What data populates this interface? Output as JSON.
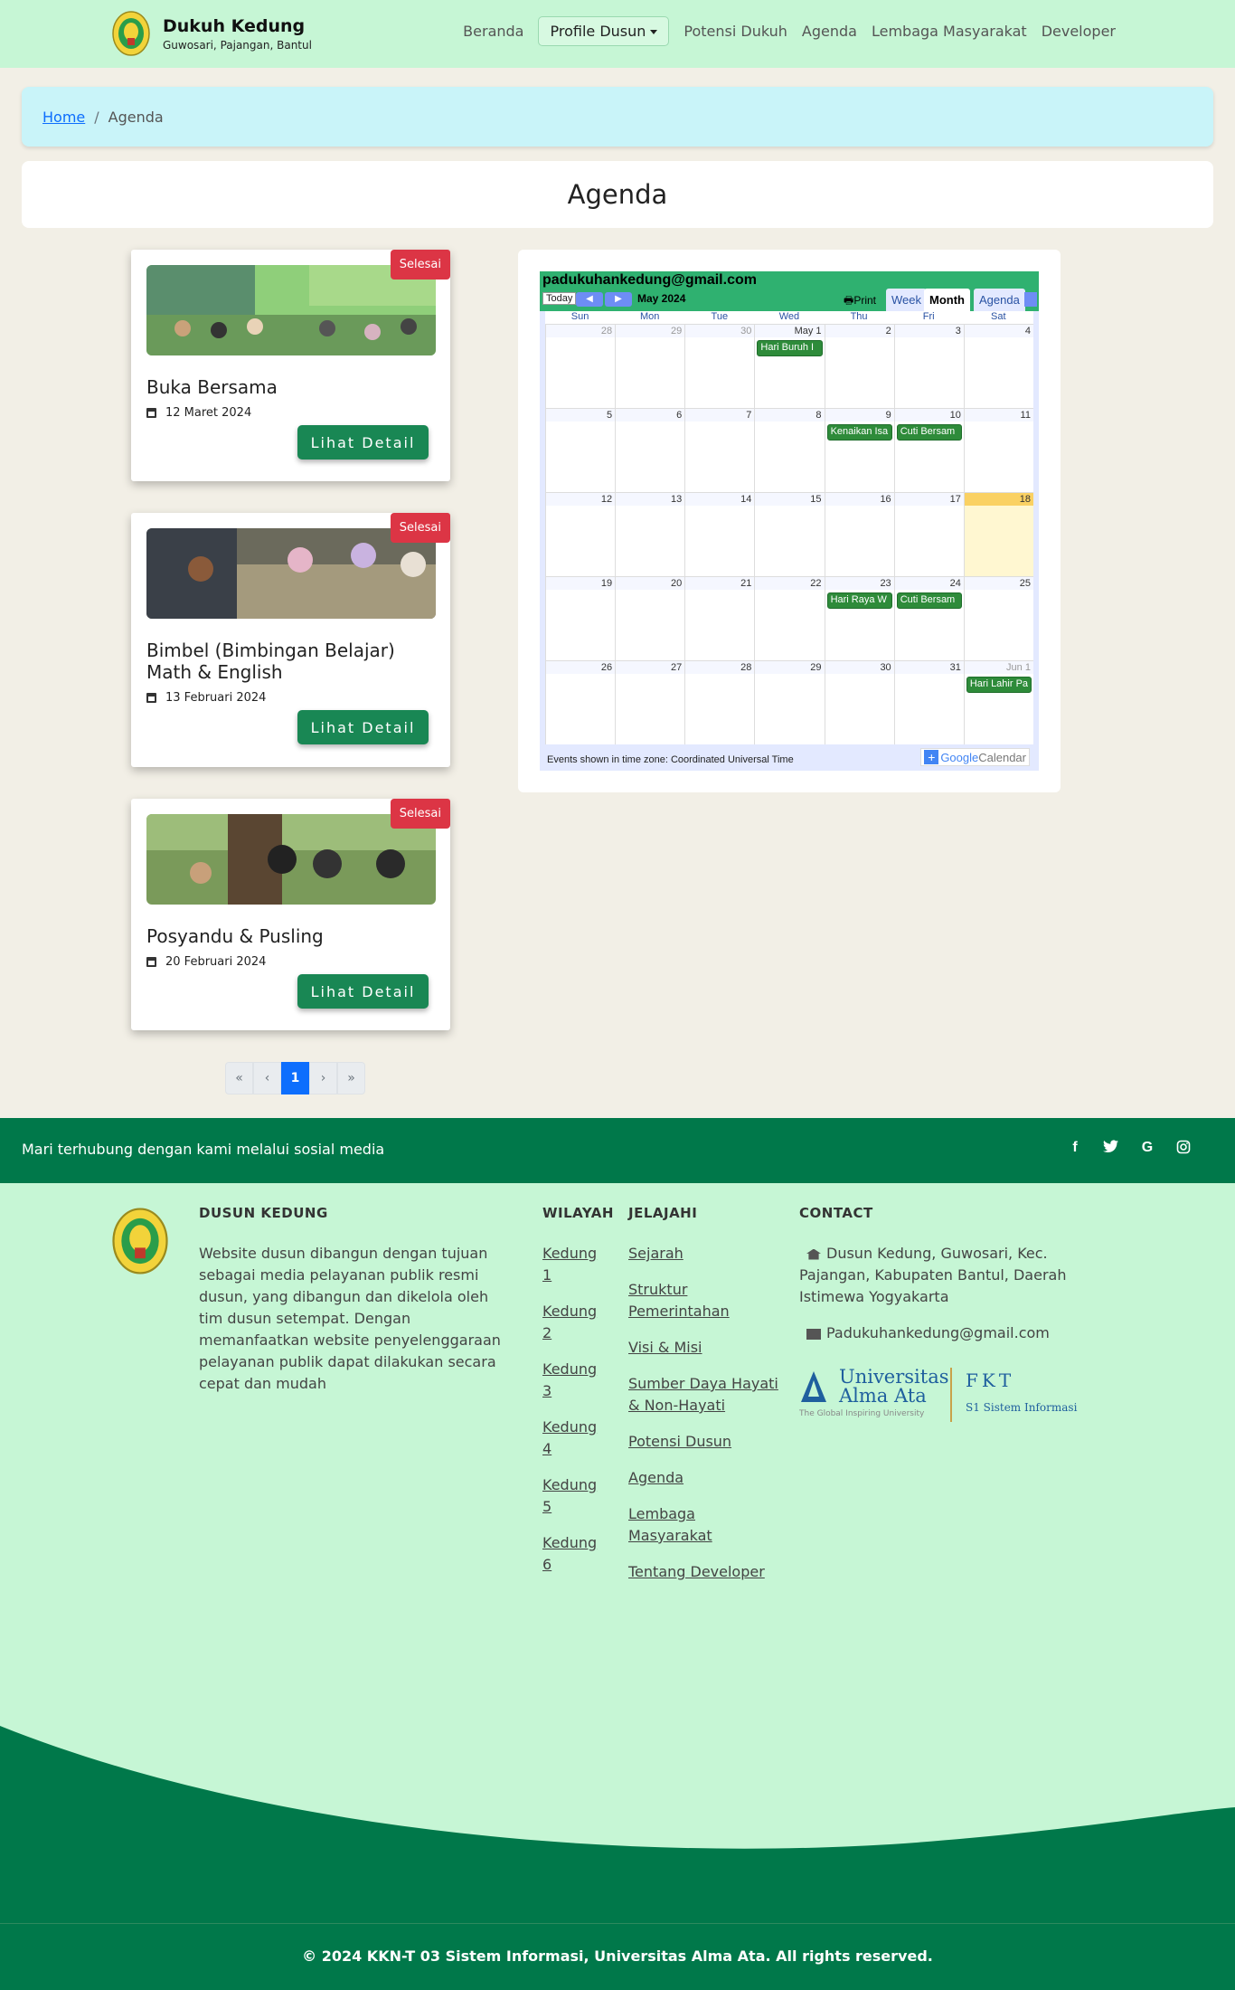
{
  "brand": {
    "title": "Dukuh Kedung",
    "subtitle": "Guwosari, Pajangan, Bantul"
  },
  "nav": {
    "items": [
      {
        "label": "Beranda"
      },
      {
        "label": "Profile Dusun"
      },
      {
        "label": "Potensi Dukuh"
      },
      {
        "label": "Agenda"
      },
      {
        "label": "Lembaga Masyarakat"
      },
      {
        "label": "Developer"
      }
    ]
  },
  "breadcrumb": {
    "home": "Home",
    "separator": "/",
    "current": "Agenda"
  },
  "page": {
    "title": "Agenda"
  },
  "agenda": {
    "items": [
      {
        "title": "Buka Bersama",
        "date": "12 Maret 2024",
        "status": "Selesai",
        "button": "Lihat Detail"
      },
      {
        "title": "Bimbel (Bimbingan Belajar) Math & English",
        "date": "13 Februari 2024",
        "status": "Selesai",
        "button": "Lihat Detail"
      },
      {
        "title": "Posyandu & Pusling",
        "date": "20 Februari 2024",
        "status": "Selesai",
        "button": "Lihat Detail"
      }
    ]
  },
  "pagination": {
    "first": "«",
    "prev": "‹",
    "current": "1",
    "next": "›",
    "last": "»"
  },
  "calendar": {
    "email": "padukuhankedung@gmail.com",
    "today_label": "Today",
    "month_label": "May 2024",
    "print_label": "Print",
    "tabs": [
      "Week",
      "Month",
      "Agenda"
    ],
    "active_tab": "Month",
    "days_of_week": [
      "Sun",
      "Mon",
      "Tue",
      "Wed",
      "Thu",
      "Fri",
      "Sat"
    ],
    "weeks": [
      [
        "28",
        "29",
        "30",
        "May 1",
        "2",
        "3",
        "4"
      ],
      [
        "5",
        "6",
        "7",
        "8",
        "9",
        "10",
        "11"
      ],
      [
        "12",
        "13",
        "14",
        "15",
        "16",
        "17",
        "18"
      ],
      [
        "19",
        "20",
        "21",
        "22",
        "23",
        "24",
        "25"
      ],
      [
        "26",
        "27",
        "28",
        "29",
        "30",
        "31",
        "Jun 1"
      ]
    ],
    "events": [
      {
        "week": 0,
        "day": 3,
        "label": "Hari Buruh I"
      },
      {
        "week": 1,
        "day": 4,
        "label": "Kenaikan Isa"
      },
      {
        "week": 1,
        "day": 5,
        "label": "Cuti Bersam"
      },
      {
        "week": 3,
        "day": 4,
        "label": "Hari Raya W"
      },
      {
        "week": 3,
        "day": 5,
        "label": "Cuti Bersam"
      },
      {
        "week": 4,
        "day": 6,
        "label": "Hari Lahir Pa"
      }
    ],
    "timezone_note": "Events shown in time zone: Coordinated Universal Time",
    "badge_google": "Google",
    "badge_calendar": "Calendar"
  },
  "social": {
    "text": "Mari terhubung dengan kami melalui sosial media",
    "icons": [
      "facebook-icon",
      "twitter-icon",
      "google-icon",
      "instagram-icon"
    ]
  },
  "footer": {
    "about_heading": "DUSUN KEDUNG",
    "about_text": "Website dusun dibangun dengan tujuan sebagai media pelayanan publik resmi dusun, yang dibangun dan dikelola oleh tim dusun setempat. Dengan memanfaatkan website penyelenggaraan pelayanan publik dapat dilakukan secara cepat dan mudah",
    "wilayah_heading": "WILAYAH",
    "wilayah": [
      "Kedung 1",
      "Kedung 2",
      "Kedung 3",
      "Kedung 4",
      "Kedung 5",
      "Kedung 6"
    ],
    "jelajahi_heading": "JELAJAHI",
    "jelajahi": [
      "Sejarah",
      "Struktur Pemerintahan",
      "Visi & Misi",
      "Sumber Daya Hayati & Non-Hayati",
      "Potensi Dusun",
      "Agenda",
      "Lembaga Masyarakat",
      "Tentang Developer"
    ],
    "contact_heading": "CONTACT",
    "address": "Dusun Kedung, Guwosari, Kec. Pajangan, Kabupaten Bantul, Daerah Istimewa Yogyakarta",
    "email": "Padukuhankedung@gmail.com",
    "partner_uni_line1": "Universitas",
    "partner_uni_line2": "Alma Ata",
    "partner_tagline": "The Global Inspiring University",
    "partner_fkt": "FKT",
    "partner_program": "S1 Sistem Informasi",
    "copyright": "© 2024 KKN-T 03 Sistem Informasi, Universitas Alma Ata. All rights reserved."
  },
  "colors": {
    "nav_bg": "#c6f6d5",
    "footer_dark": "#00784a",
    "button_green": "#198754",
    "badge_red": "#dc3545",
    "breadcrumb_bg": "#c9f4f9"
  }
}
